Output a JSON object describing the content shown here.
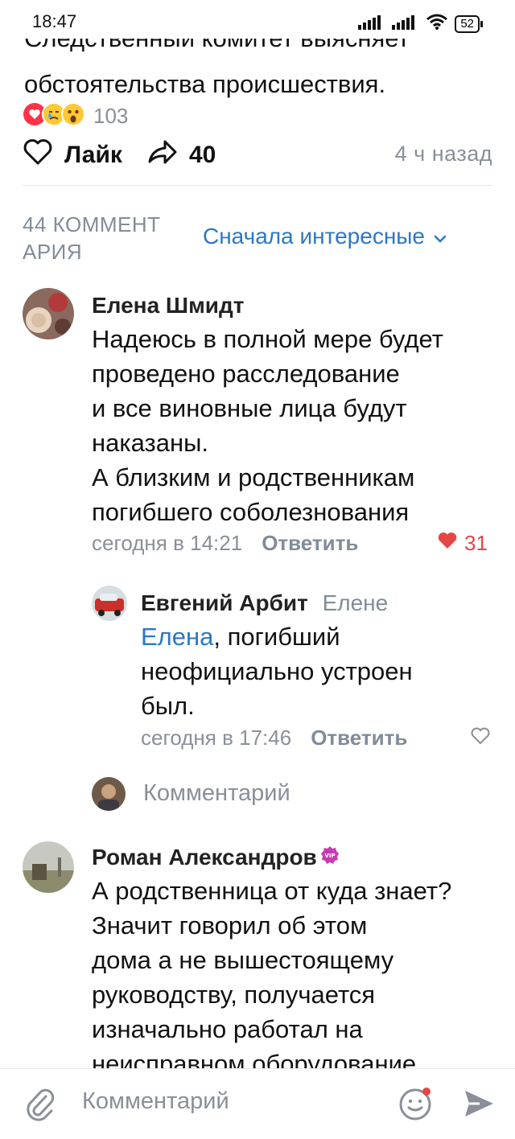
{
  "status_bar": {
    "time": "18:47",
    "battery": "52"
  },
  "post": {
    "text_clipped": "Следственный комитет выясняет",
    "text_line2": "обстоятельства происшествия.",
    "reactions_count": "103",
    "like_label": "Лайк",
    "shares_count": "40",
    "time_ago": "4 ч назад"
  },
  "comments_header": {
    "count_label": "44 КОММЕНТ АРИЯ",
    "sort_label": "Сначала интересные"
  },
  "comments": [
    {
      "author": "Елена Шмидт",
      "lines": [
        "Надеюсь в полной мере будет",
        "проведено расследование",
        "и все виновные лица будут",
        "наказаны.",
        "А близким и родственникам",
        "погибшего соболезнования"
      ],
      "time": "сегодня в 14:21",
      "reply_label": "Ответить",
      "likes": "31"
    },
    {
      "author": "Евгений Арбит",
      "to": "Елене",
      "mention": "Елена",
      "line1_rest": ", погибший",
      "line2": "неофициально устроен",
      "line3": "был.",
      "time": "сегодня в 17:46",
      "reply_label": "Ответить"
    },
    {
      "author": "Роман Александров",
      "lines": [
        "А родственница от куда знает?",
        "Значит говорил об этом",
        "дома а не вышестоящему",
        "руководству, получается",
        "изначально работал на",
        "неисправном оборудование."
      ]
    }
  ],
  "inline_reply_placeholder": "Комментарий",
  "composer": {
    "placeholder": "Комментарий"
  },
  "colors": {
    "accent": "#2a78c7",
    "muted": "#8a8f99",
    "like_red": "#e64646"
  },
  "icons": {
    "vip_badge": "vip-badge-icon",
    "attach": "paperclip-icon",
    "emoji": "smile-icon",
    "send": "send-icon"
  }
}
